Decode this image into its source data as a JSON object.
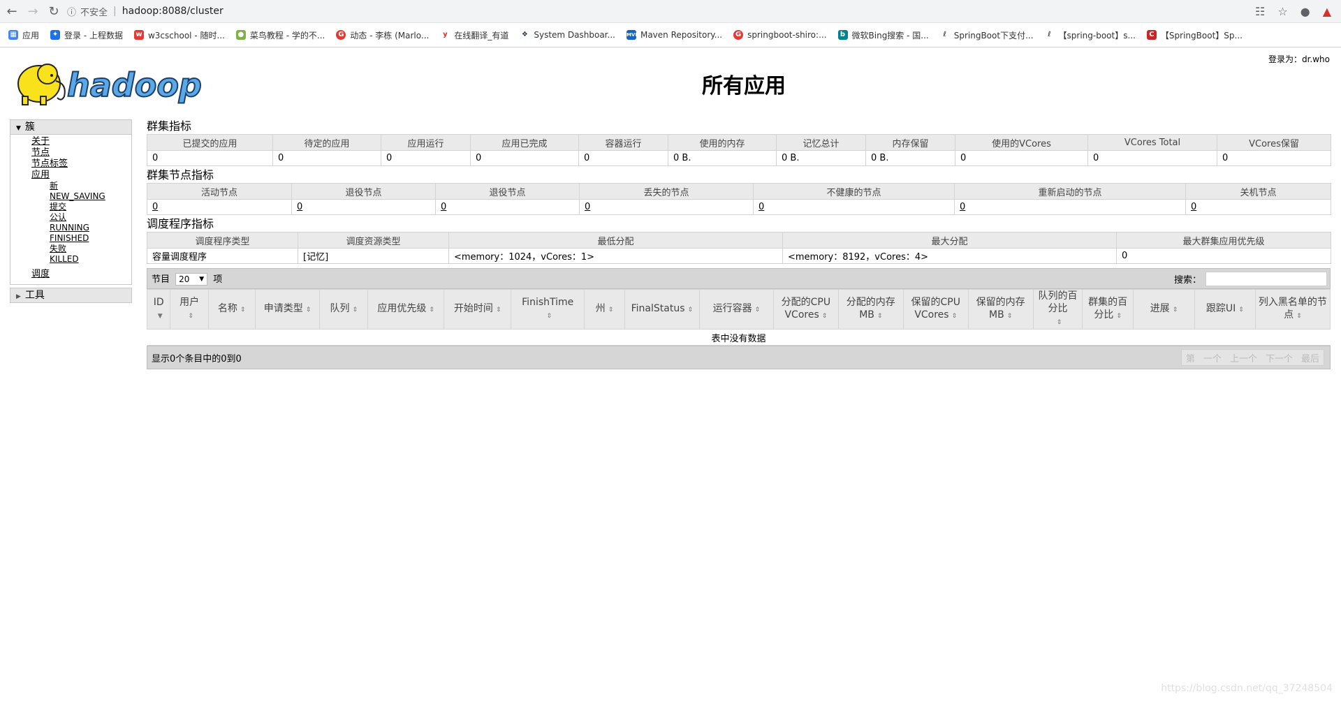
{
  "browser": {
    "insecure_label": "不安全",
    "url": "hadoop:8088/cluster",
    "bookmarks": [
      "应用",
      "登录 - 上程数据",
      "w3cschool - 随时...",
      "菜鸟教程 - 学的不...",
      "动态 - 李栋 (Marlo...",
      "在线翻译_有道",
      "System Dashboar...",
      "Maven Repository...",
      "springboot-shiro:...",
      "微软Bing搜索 - 国...",
      "SpringBoot下支付...",
      "【spring-boot】s...",
      "【SpringBoot】Sp..."
    ]
  },
  "header": {
    "logo_text": "hadoop",
    "title": "所有应用",
    "login": "登录为：dr.who"
  },
  "sidebar": {
    "cluster_label": "簇",
    "links": [
      "关于",
      "节点",
      "节点标签",
      "应用"
    ],
    "app_states": [
      "新",
      "NEW_SAVING",
      "提交",
      "公认",
      "RUNNING",
      "FINISHED",
      "失败",
      "KILLED"
    ],
    "scheduler_label": "调度",
    "tools_label": "工具"
  },
  "cluster_metrics": {
    "title": "群集指标",
    "headers": [
      "已提交的应用",
      "待定的应用",
      "应用运行",
      "应用已完成",
      "容器运行",
      "使用的内存",
      "记忆总计",
      "内存保留",
      "使用的VCores",
      "VCores Total",
      "VCores保留"
    ],
    "values": [
      "0",
      "0",
      "0",
      "0",
      "0",
      "0 B.",
      "0 B.",
      "0 B.",
      "0",
      "0",
      "0"
    ]
  },
  "node_metrics": {
    "title": "群集节点指标",
    "headers": [
      "活动节点",
      "退役节点",
      "退役节点",
      "丢失的节点",
      "不健康的节点",
      "重新启动的节点",
      "关机节点"
    ],
    "values": [
      "0",
      "0",
      "0",
      "0",
      "0",
      "0",
      "0"
    ]
  },
  "scheduler_metrics": {
    "title": "调度程序指标",
    "headers": [
      "调度程序类型",
      "调度资源类型",
      "最低分配",
      "最大分配",
      "最大群集应用优先级"
    ],
    "values": [
      "容量调度程序",
      "[记忆]",
      "<memory：1024，vCores：1>",
      "<memory：8192，vCores：4>",
      "0"
    ]
  },
  "apps_table": {
    "show_label": "节目",
    "page_length": "20",
    "entries_label": "项",
    "search_label": "搜索：",
    "columns": [
      "ID",
      "用户",
      "名称",
      "申请类型",
      "队列",
      "应用优先级",
      "开始时间",
      "FinishTime",
      "州",
      "FinalStatus",
      "运行容器",
      "分配的CPU VCores",
      "分配的内存MB",
      "保留的CPU VCores",
      "保留的内存MB",
      "队列的百分比",
      "群集的百分比",
      "进展",
      "跟踪UI",
      "列入黑名单的节点"
    ],
    "empty_text": "表中没有数据",
    "info": "显示0个条目中的0到0",
    "pager": [
      "第",
      "一个",
      "上一个",
      "下一个",
      "最后"
    ]
  },
  "watermark": "https://blog.csdn.net/qq_37248504"
}
